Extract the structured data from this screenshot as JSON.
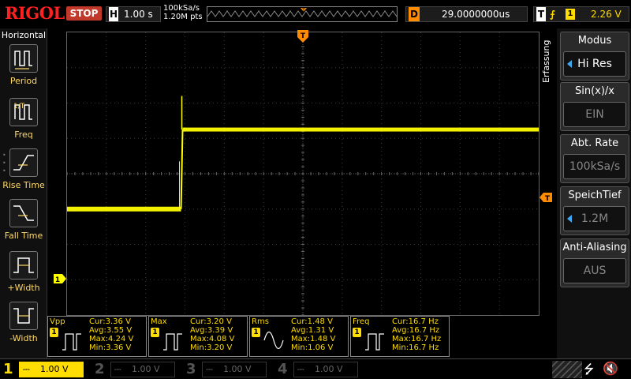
{
  "brand": "RIGOL",
  "run_state": "STOP",
  "horizontal": {
    "label": "H",
    "timebase": "1.00 s"
  },
  "acquisition": {
    "sample_rate": "100kSa/s",
    "points": "1.20M pts"
  },
  "delay": {
    "label": "D",
    "value": "29.0000000us"
  },
  "trigger": {
    "label": "T",
    "edge": "⨍",
    "channel": "1",
    "level": "2.26 V"
  },
  "left_menu": {
    "title": "Horizontal",
    "items": [
      {
        "label": "Period",
        "icon": "period-icon"
      },
      {
        "label": "Freq",
        "icon": "freq-icon"
      },
      {
        "label": "Rise Time",
        "icon": "rise-time-icon"
      },
      {
        "label": "Fall Time",
        "icon": "fall-time-icon"
      },
      {
        "label": "+Width",
        "icon": "plus-width-icon"
      },
      {
        "label": "-Width",
        "icon": "minus-width-icon"
      }
    ]
  },
  "right_menu": {
    "vertical_label": "Erfassung",
    "items": [
      {
        "title": "Modus",
        "value": "Hi Res",
        "arrow": true,
        "dim": false
      },
      {
        "title": "Sin(x)/x",
        "value": "EIN",
        "arrow": false,
        "dim": true
      },
      {
        "title": "Abt. Rate",
        "value": "100kSa/s",
        "arrow": false,
        "dim": true
      },
      {
        "title": "SpeichTief",
        "value": "1.2M",
        "arrow": true,
        "dim": true
      },
      {
        "title": "Anti-Aliasing",
        "value": "AUS",
        "arrow": false,
        "dim": true
      }
    ]
  },
  "measurements": [
    {
      "name": "Vpp",
      "channel": "1",
      "cur": "Cur:3.36 V",
      "avg": "Avg:3.55 V",
      "max": "Max:4.24 V",
      "min": "Min:3.36 V"
    },
    {
      "name": "Max",
      "channel": "1",
      "cur": "Cur:3.20 V",
      "avg": "Avg:3.39 V",
      "max": "Max:4.08 V",
      "min": "Min:3.20 V"
    },
    {
      "name": "Rms",
      "channel": "1",
      "cur": "Cur:1.48 V",
      "avg": "Avg:1.31 V",
      "max": "Max:1.48 V",
      "min": "Min:1.06 V"
    },
    {
      "name": "Freq",
      "channel": "1",
      "cur": "Cur:16.7 Hz",
      "avg": "Avg:16.7 Hz",
      "max": "Max:16.7 Hz",
      "min": "Min:16.7 Hz"
    }
  ],
  "channels": [
    {
      "num": "1",
      "coupling": "⎓",
      "scale": "1.00 V",
      "active": true
    },
    {
      "num": "2",
      "coupling": "⎓",
      "scale": "1.00 V",
      "active": false
    },
    {
      "num": "3",
      "coupling": "⎓",
      "scale": "1.00 V",
      "active": false
    },
    {
      "num": "4",
      "coupling": "⎓",
      "scale": "1.00 V",
      "active": false
    }
  ],
  "waveform": {
    "channel_marker": "1",
    "color": "#ffff00",
    "low_level_div": -1.0,
    "high_level_div": 1.25,
    "spike_level_div": 2.2,
    "edge_time_div": 2.9,
    "trigger_marker": "T"
  },
  "colors": {
    "ch1": "#ffff00",
    "trigger": "#ff8c00",
    "stop": "#c0392b",
    "grid": "#3a3a3a"
  }
}
